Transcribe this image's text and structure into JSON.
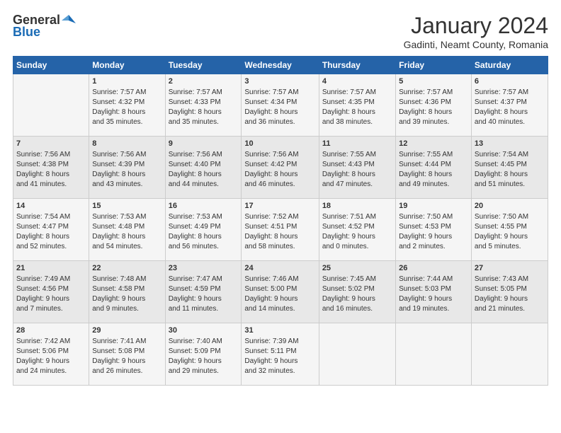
{
  "logo": {
    "general": "General",
    "blue": "Blue"
  },
  "title": "January 2024",
  "location": "Gadinti, Neamt County, Romania",
  "days_header": [
    "Sunday",
    "Monday",
    "Tuesday",
    "Wednesday",
    "Thursday",
    "Friday",
    "Saturday"
  ],
  "weeks": [
    [
      {
        "day": "",
        "content": ""
      },
      {
        "day": "1",
        "content": "Sunrise: 7:57 AM\nSunset: 4:32 PM\nDaylight: 8 hours\nand 35 minutes."
      },
      {
        "day": "2",
        "content": "Sunrise: 7:57 AM\nSunset: 4:33 PM\nDaylight: 8 hours\nand 35 minutes."
      },
      {
        "day": "3",
        "content": "Sunrise: 7:57 AM\nSunset: 4:34 PM\nDaylight: 8 hours\nand 36 minutes."
      },
      {
        "day": "4",
        "content": "Sunrise: 7:57 AM\nSunset: 4:35 PM\nDaylight: 8 hours\nand 38 minutes."
      },
      {
        "day": "5",
        "content": "Sunrise: 7:57 AM\nSunset: 4:36 PM\nDaylight: 8 hours\nand 39 minutes."
      },
      {
        "day": "6",
        "content": "Sunrise: 7:57 AM\nSunset: 4:37 PM\nDaylight: 8 hours\nand 40 minutes."
      }
    ],
    [
      {
        "day": "7",
        "content": "Sunrise: 7:56 AM\nSunset: 4:38 PM\nDaylight: 8 hours\nand 41 minutes."
      },
      {
        "day": "8",
        "content": "Sunrise: 7:56 AM\nSunset: 4:39 PM\nDaylight: 8 hours\nand 43 minutes."
      },
      {
        "day": "9",
        "content": "Sunrise: 7:56 AM\nSunset: 4:40 PM\nDaylight: 8 hours\nand 44 minutes."
      },
      {
        "day": "10",
        "content": "Sunrise: 7:56 AM\nSunset: 4:42 PM\nDaylight: 8 hours\nand 46 minutes."
      },
      {
        "day": "11",
        "content": "Sunrise: 7:55 AM\nSunset: 4:43 PM\nDaylight: 8 hours\nand 47 minutes."
      },
      {
        "day": "12",
        "content": "Sunrise: 7:55 AM\nSunset: 4:44 PM\nDaylight: 8 hours\nand 49 minutes."
      },
      {
        "day": "13",
        "content": "Sunrise: 7:54 AM\nSunset: 4:45 PM\nDaylight: 8 hours\nand 51 minutes."
      }
    ],
    [
      {
        "day": "14",
        "content": "Sunrise: 7:54 AM\nSunset: 4:47 PM\nDaylight: 8 hours\nand 52 minutes."
      },
      {
        "day": "15",
        "content": "Sunrise: 7:53 AM\nSunset: 4:48 PM\nDaylight: 8 hours\nand 54 minutes."
      },
      {
        "day": "16",
        "content": "Sunrise: 7:53 AM\nSunset: 4:49 PM\nDaylight: 8 hours\nand 56 minutes."
      },
      {
        "day": "17",
        "content": "Sunrise: 7:52 AM\nSunset: 4:51 PM\nDaylight: 8 hours\nand 58 minutes."
      },
      {
        "day": "18",
        "content": "Sunrise: 7:51 AM\nSunset: 4:52 PM\nDaylight: 9 hours\nand 0 minutes."
      },
      {
        "day": "19",
        "content": "Sunrise: 7:50 AM\nSunset: 4:53 PM\nDaylight: 9 hours\nand 2 minutes."
      },
      {
        "day": "20",
        "content": "Sunrise: 7:50 AM\nSunset: 4:55 PM\nDaylight: 9 hours\nand 5 minutes."
      }
    ],
    [
      {
        "day": "21",
        "content": "Sunrise: 7:49 AM\nSunset: 4:56 PM\nDaylight: 9 hours\nand 7 minutes."
      },
      {
        "day": "22",
        "content": "Sunrise: 7:48 AM\nSunset: 4:58 PM\nDaylight: 9 hours\nand 9 minutes."
      },
      {
        "day": "23",
        "content": "Sunrise: 7:47 AM\nSunset: 4:59 PM\nDaylight: 9 hours\nand 11 minutes."
      },
      {
        "day": "24",
        "content": "Sunrise: 7:46 AM\nSunset: 5:00 PM\nDaylight: 9 hours\nand 14 minutes."
      },
      {
        "day": "25",
        "content": "Sunrise: 7:45 AM\nSunset: 5:02 PM\nDaylight: 9 hours\nand 16 minutes."
      },
      {
        "day": "26",
        "content": "Sunrise: 7:44 AM\nSunset: 5:03 PM\nDaylight: 9 hours\nand 19 minutes."
      },
      {
        "day": "27",
        "content": "Sunrise: 7:43 AM\nSunset: 5:05 PM\nDaylight: 9 hours\nand 21 minutes."
      }
    ],
    [
      {
        "day": "28",
        "content": "Sunrise: 7:42 AM\nSunset: 5:06 PM\nDaylight: 9 hours\nand 24 minutes."
      },
      {
        "day": "29",
        "content": "Sunrise: 7:41 AM\nSunset: 5:08 PM\nDaylight: 9 hours\nand 26 minutes."
      },
      {
        "day": "30",
        "content": "Sunrise: 7:40 AM\nSunset: 5:09 PM\nDaylight: 9 hours\nand 29 minutes."
      },
      {
        "day": "31",
        "content": "Sunrise: 7:39 AM\nSunset: 5:11 PM\nDaylight: 9 hours\nand 32 minutes."
      },
      {
        "day": "",
        "content": ""
      },
      {
        "day": "",
        "content": ""
      },
      {
        "day": "",
        "content": ""
      }
    ]
  ]
}
